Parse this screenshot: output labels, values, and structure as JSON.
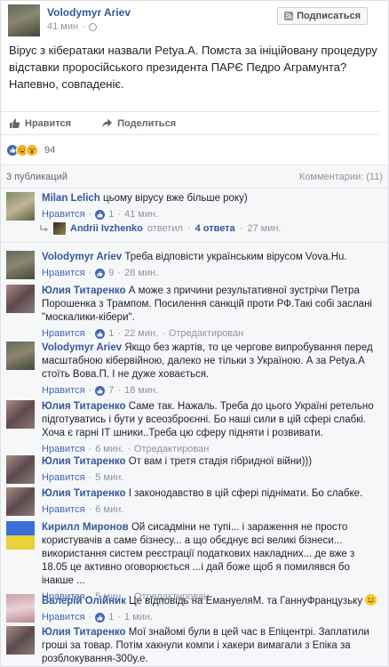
{
  "post": {
    "author": "Volodymyr Ariev",
    "time": "41 мин",
    "follow_label": "Подписаться",
    "text": "Вірус з кібератаки назвали Petya.A. Помста за ініційовану процедуру відставки проросійського президента ПАРЄ Педро Аграмунта? Напевно, совпаденіє.",
    "like_label": "Нравится",
    "share_label": "Поделиться",
    "reactions_count": "94"
  },
  "meta": {
    "shares": "3 публикаций",
    "comments": "Комментарии: (11)"
  },
  "comments": [
    {
      "name": "Milan Lelich",
      "text": "цьому вірусу вже більше року)",
      "like": "Нравится",
      "likes": "1",
      "time": "41 мин."
    },
    {
      "name": "Volodymyr Ariev",
      "text": "Треба відповісти українським вірусом Vova.Hu.",
      "like": "Нравится",
      "likes": "9",
      "time": "28 мин."
    },
    {
      "name": "Юлия Титаренко",
      "text": "А може з причини результативної зустрічи Петра Порошенка з Трампом. Посилення санкцій проти РФ.Такі собі заслані \"москалики-кібери\".",
      "like": "Нравится",
      "likes": "1",
      "time": "22 мин.",
      "edited": "Отредактирован"
    },
    {
      "name": "Volodymyr Ariev",
      "text": "Якщо без жартів, то це чергове випробування перед масштабною кібервійною, далеко не тільки з Україною. А за Petya.A стоїть Вова.П. І не дуже ховається.",
      "like": "Нравится",
      "likes": "7",
      "time": "18 мин."
    },
    {
      "name": "Юлия Титаренко",
      "text": "Саме так. Нажаль. Треба до цього Україні ретельно підготуватись і бути у всеозброєнні. Бо наші сили в цій сфері слабкі. Хоча є гарні ІТ шники..Треба цю сферу підняти і розвивати.",
      "like": "Нравится",
      "time": "6 мин.",
      "edited": "Отредактирован"
    },
    {
      "name": "Юлия Титаренко",
      "text": "От вам і третя стадія гібридної війни)))",
      "like": "Нравится",
      "time": "5 мин."
    },
    {
      "name": "Юлия Титаренко",
      "text": "І законодавство в цій сфері піднімати. Бо слабке.",
      "like": "Нравится",
      "time": "6 мин."
    },
    {
      "name": "Кирилл Миронов",
      "text": "Ой сисадміни не тупі... і зараження не просто користувачів а саме бізнесу... а що обєднує всі великі бізнеси... використання систем реєстрації податкових накладних... де вже з 18.05 це активно оговорюється ...і дай боже щоб я помилявся бо інакше ...",
      "like": "Нравится",
      "time": "5 мин.",
      "edited": "Отредактирован"
    },
    {
      "name": "Валерій Олійник",
      "text": "Це відповідь на ЕмануеляМ. та ГаннуФранцузьку",
      "like": "Нравится",
      "likes": "1",
      "time": "1 мин."
    },
    {
      "name": "Юлия Титаренко",
      "text": "Мої знайомі були в цей час в Епіцентрі. Заплатили гроші за товар. Потім хакнули компи і хакери вимагали з Епіка за розблокування-300у.е.",
      "like": "",
      "time": ""
    }
  ],
  "reply": {
    "name": "Andrii Ivzhenko",
    "action": "ответил",
    "count": "4 ответа",
    "time": "27 мин."
  },
  "separator": "·",
  "colors": {
    "link": "#365899",
    "like_blue": "#4267b2",
    "muted": "#90949c"
  }
}
